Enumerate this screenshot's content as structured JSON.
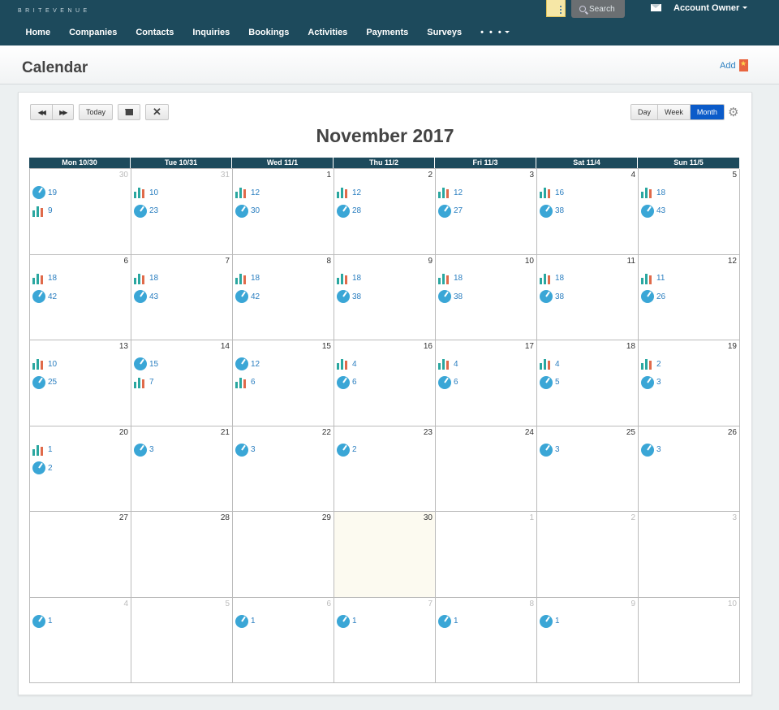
{
  "brand": "BRITEVENUE",
  "header": {
    "search_label": "Search",
    "account_label": "Account Owner",
    "nav": [
      "Home",
      "Companies",
      "Contacts",
      "Inquiries",
      "Bookings",
      "Activities",
      "Payments",
      "Surveys"
    ],
    "more_label": "• • •"
  },
  "page": {
    "title": "Calendar",
    "add_label": "Add"
  },
  "toolbar": {
    "prev_label": "◀◀",
    "next_label": "▶▶",
    "today_label": "Today",
    "close_label": "✕",
    "views": [
      "Day",
      "Week",
      "Month"
    ],
    "active_view": "Month"
  },
  "calendar": {
    "title": "November 2017",
    "headers": [
      "Mon 10/30",
      "Tue 10/31",
      "Wed 11/1",
      "Thu 11/2",
      "Fri 11/3",
      "Sat 11/4",
      "Sun 11/5"
    ],
    "weeks": [
      [
        {
          "day": "30",
          "other": true,
          "events": [
            {
              "type": "pie",
              "value": "19"
            },
            {
              "type": "bar",
              "value": "9"
            }
          ]
        },
        {
          "day": "31",
          "other": true,
          "events": [
            {
              "type": "bar",
              "value": "10"
            },
            {
              "type": "pie",
              "value": "23"
            }
          ]
        },
        {
          "day": "1",
          "events": [
            {
              "type": "bar",
              "value": "12"
            },
            {
              "type": "pie",
              "value": "30"
            }
          ]
        },
        {
          "day": "2",
          "events": [
            {
              "type": "bar",
              "value": "12"
            },
            {
              "type": "pie",
              "value": "28"
            }
          ]
        },
        {
          "day": "3",
          "events": [
            {
              "type": "bar",
              "value": "12"
            },
            {
              "type": "pie",
              "value": "27"
            }
          ]
        },
        {
          "day": "4",
          "events": [
            {
              "type": "bar",
              "value": "16"
            },
            {
              "type": "pie",
              "value": "38"
            }
          ]
        },
        {
          "day": "5",
          "events": [
            {
              "type": "bar",
              "value": "18"
            },
            {
              "type": "pie",
              "value": "43"
            }
          ]
        }
      ],
      [
        {
          "day": "6",
          "events": [
            {
              "type": "bar",
              "value": "18"
            },
            {
              "type": "pie",
              "value": "42"
            }
          ]
        },
        {
          "day": "7",
          "events": [
            {
              "type": "bar",
              "value": "18"
            },
            {
              "type": "pie",
              "value": "43"
            }
          ]
        },
        {
          "day": "8",
          "events": [
            {
              "type": "bar",
              "value": "18"
            },
            {
              "type": "pie",
              "value": "42"
            }
          ]
        },
        {
          "day": "9",
          "events": [
            {
              "type": "bar",
              "value": "18"
            },
            {
              "type": "pie",
              "value": "38"
            }
          ]
        },
        {
          "day": "10",
          "events": [
            {
              "type": "bar",
              "value": "18"
            },
            {
              "type": "pie",
              "value": "38"
            }
          ]
        },
        {
          "day": "11",
          "events": [
            {
              "type": "bar",
              "value": "18"
            },
            {
              "type": "pie",
              "value": "38"
            }
          ]
        },
        {
          "day": "12",
          "events": [
            {
              "type": "bar",
              "value": "11"
            },
            {
              "type": "pie",
              "value": "26"
            }
          ]
        }
      ],
      [
        {
          "day": "13",
          "events": [
            {
              "type": "bar",
              "value": "10"
            },
            {
              "type": "pie",
              "value": "25"
            }
          ]
        },
        {
          "day": "14",
          "events": [
            {
              "type": "pie",
              "value": "15"
            },
            {
              "type": "bar",
              "value": "7"
            }
          ]
        },
        {
          "day": "15",
          "events": [
            {
              "type": "pie",
              "value": "12"
            },
            {
              "type": "bar",
              "value": "6"
            }
          ]
        },
        {
          "day": "16",
          "events": [
            {
              "type": "bar",
              "value": "4"
            },
            {
              "type": "pie",
              "value": "6"
            }
          ]
        },
        {
          "day": "17",
          "events": [
            {
              "type": "bar",
              "value": "4"
            },
            {
              "type": "pie",
              "value": "6"
            }
          ]
        },
        {
          "day": "18",
          "events": [
            {
              "type": "bar",
              "value": "4"
            },
            {
              "type": "pie",
              "value": "5"
            }
          ]
        },
        {
          "day": "19",
          "events": [
            {
              "type": "bar",
              "value": "2"
            },
            {
              "type": "pie",
              "value": "3"
            }
          ]
        }
      ],
      [
        {
          "day": "20",
          "events": [
            {
              "type": "bar",
              "value": "1"
            },
            {
              "type": "pie",
              "value": "2"
            }
          ]
        },
        {
          "day": "21",
          "events": [
            {
              "type": "pie",
              "value": "3"
            }
          ]
        },
        {
          "day": "22",
          "events": [
            {
              "type": "pie",
              "value": "3"
            }
          ]
        },
        {
          "day": "23",
          "events": [
            {
              "type": "pie",
              "value": "2"
            }
          ]
        },
        {
          "day": "24",
          "events": []
        },
        {
          "day": "25",
          "events": [
            {
              "type": "pie",
              "value": "3"
            }
          ]
        },
        {
          "day": "26",
          "events": [
            {
              "type": "pie",
              "value": "3"
            }
          ]
        }
      ],
      [
        {
          "day": "27",
          "events": []
        },
        {
          "day": "28",
          "events": []
        },
        {
          "day": "29",
          "events": []
        },
        {
          "day": "30",
          "today": true,
          "events": []
        },
        {
          "day": "1",
          "other": true,
          "events": []
        },
        {
          "day": "2",
          "other": true,
          "events": []
        },
        {
          "day": "3",
          "other": true,
          "events": []
        }
      ],
      [
        {
          "day": "4",
          "other": true,
          "events": [
            {
              "type": "pie",
              "value": "1"
            }
          ]
        },
        {
          "day": "5",
          "other": true,
          "events": []
        },
        {
          "day": "6",
          "other": true,
          "events": [
            {
              "type": "pie",
              "value": "1"
            }
          ]
        },
        {
          "day": "7",
          "other": true,
          "events": [
            {
              "type": "pie",
              "value": "1"
            }
          ]
        },
        {
          "day": "8",
          "other": true,
          "events": [
            {
              "type": "pie",
              "value": "1"
            }
          ]
        },
        {
          "day": "9",
          "other": true,
          "events": [
            {
              "type": "pie",
              "value": "1"
            }
          ]
        },
        {
          "day": "10",
          "other": true,
          "events": []
        }
      ]
    ]
  }
}
